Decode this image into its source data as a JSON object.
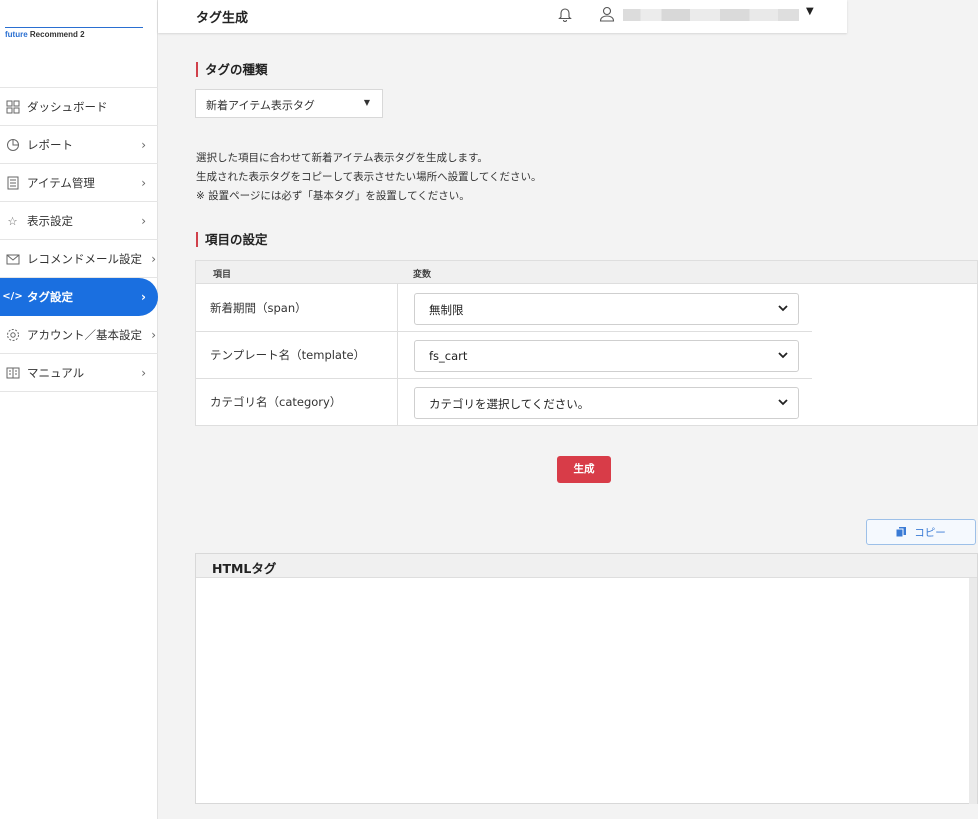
{
  "logo": {
    "part1": "future",
    "part2": " Recommend 2"
  },
  "sidebar": {
    "items": [
      {
        "label": "ダッシュボード",
        "icon": "dashboard-icon"
      },
      {
        "label": "レポート",
        "icon": "report-icon"
      },
      {
        "label": "アイテム管理",
        "icon": "item-icon"
      },
      {
        "label": "表示設定",
        "icon": "star-icon"
      },
      {
        "label": "レコメンドメール設定",
        "icon": "mail-icon"
      },
      {
        "label": "タグ設定",
        "icon": "code-icon",
        "active": true
      },
      {
        "label": "アカウント／基本設定",
        "icon": "gear-icon"
      },
      {
        "label": "マニュアル",
        "icon": "book-icon"
      }
    ]
  },
  "header": {
    "title": "タグ生成"
  },
  "tag_type": {
    "title": "タグの種類",
    "selected": "新着アイテム表示タグ"
  },
  "description": {
    "line1": "選択した項目に合わせて新着アイテム表示タグを生成します。",
    "line2": "生成された表示タグをコピーして表示させたい場所へ設置してください。",
    "line3": "※ 設置ページには必ず「基本タグ」を設置してください。"
  },
  "settings": {
    "title": "項目の設定",
    "col1": "項目",
    "col2": "変数",
    "rows": [
      {
        "label": "新着期間（span）",
        "value": "無制限"
      },
      {
        "label": "テンプレート名（template）",
        "value": "fs_cart"
      },
      {
        "label": "カテゴリ名（category）",
        "value": "カテゴリを選択してください。"
      }
    ]
  },
  "buttons": {
    "generate": "生成",
    "copy": "コピー"
  },
  "html_tag": {
    "title": "HTMLタグ"
  },
  "colors": {
    "accent": "#1a6fe0",
    "danger": "#d83c48",
    "section_mark": "#d0404a"
  }
}
